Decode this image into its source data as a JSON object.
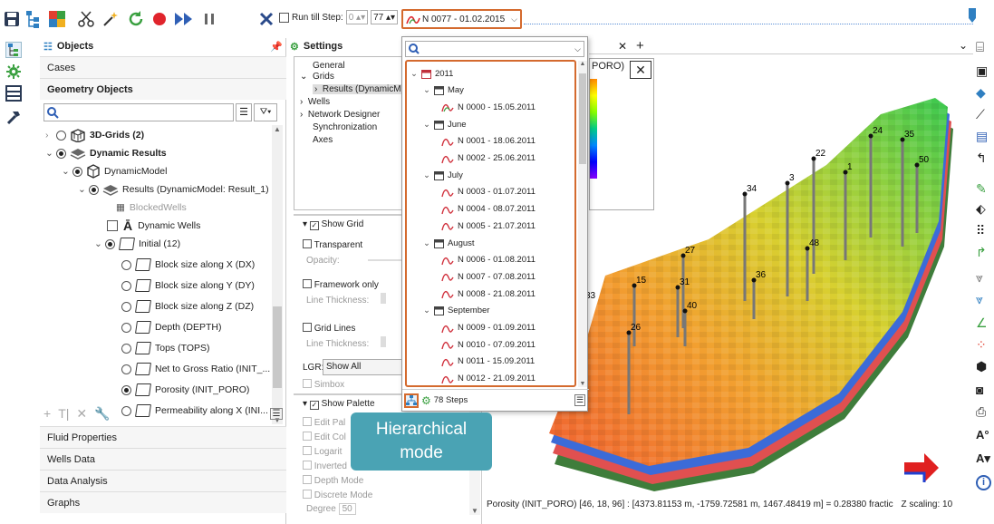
{
  "toolbar": {
    "run_till_label": "Run till Step:",
    "step_from": "0",
    "step_to": "77",
    "step_selector": "N 0077 - 01.02.2015"
  },
  "objects": {
    "title": "Objects",
    "sections_top": [
      "Cases",
      "Geometry Objects"
    ],
    "tree": [
      {
        "label": "3D-Grids (2)"
      },
      {
        "label": "Dynamic Results"
      },
      {
        "label": "DynamicModel"
      },
      {
        "label": "Results (DynamicModel: Result_1)"
      },
      {
        "label": "BlockedWells"
      },
      {
        "label": "Dynamic Wells"
      },
      {
        "label": "Initial (12)"
      },
      {
        "label": "Block size along X (DX)"
      },
      {
        "label": "Block size along Y (DY)"
      },
      {
        "label": "Block size along Z (DZ)"
      },
      {
        "label": "Depth (DEPTH)"
      },
      {
        "label": "Tops (TOPS)"
      },
      {
        "label": "Net to Gross Ratio (INIT_..."
      },
      {
        "label": "Porosity (INIT_PORO)"
      },
      {
        "label": "Permeability along X (INI..."
      }
    ],
    "sections_bottom": [
      "Fluid Properties",
      "Wells Data",
      "Data Analysis",
      "Graphs"
    ]
  },
  "settings": {
    "title": "Settings",
    "nav": [
      "General",
      "Grids",
      "Results (DynamicM",
      "Wells",
      "Network Designer",
      "Synchronization",
      "Axes"
    ],
    "show_grid": "Show Grid",
    "transparent": "Transparent",
    "opacity": "Opacity:",
    "framework_only": "Framework only",
    "line_thickness": "Line Thickness:",
    "grid_lines": "Grid Lines",
    "line_thickness2": "Line Thickness:",
    "lgr_label": "LGR:",
    "lgr_value": "Show All",
    "simbox": "Simbox",
    "show_palette": "Show Palette",
    "palette_opts": [
      "Edit Pal",
      "Edit Col",
      "Logarit",
      "Inverted",
      "Depth Mode",
      "Discrete Mode"
    ],
    "degree_label": "Degree",
    "degree_value": "50"
  },
  "popup": {
    "items": [
      {
        "label": "2011",
        "kind": "year"
      },
      {
        "label": "May",
        "kind": "month"
      },
      {
        "label": "N 0000 - 15.05.2011",
        "kind": "step"
      },
      {
        "label": "June",
        "kind": "month"
      },
      {
        "label": "N 0001 - 18.06.2011",
        "kind": "step"
      },
      {
        "label": "N 0002 - 25.06.2011",
        "kind": "step"
      },
      {
        "label": "July",
        "kind": "month"
      },
      {
        "label": "N 0003 - 01.07.2011",
        "kind": "step"
      },
      {
        "label": "N 0004 - 08.07.2011",
        "kind": "step"
      },
      {
        "label": "N 0005 - 21.07.2011",
        "kind": "step"
      },
      {
        "label": "August",
        "kind": "month"
      },
      {
        "label": "N 0006 - 01.08.2011",
        "kind": "step"
      },
      {
        "label": "N 0007 - 07.08.2011",
        "kind": "step"
      },
      {
        "label": "N 0008 - 21.08.2011",
        "kind": "step"
      },
      {
        "label": "September",
        "kind": "month"
      },
      {
        "label": "N 0009 - 01.09.2011",
        "kind": "step"
      },
      {
        "label": "N 0010 - 07.09.2011",
        "kind": "step"
      },
      {
        "label": "N 0011 - 15.09.2011",
        "kind": "step"
      },
      {
        "label": "N 0012 - 21.09.2011",
        "kind": "step"
      }
    ],
    "steps_count": "78 Steps"
  },
  "tooltip": {
    "line1": "Hierarchical",
    "line2": "mode"
  },
  "view": {
    "legend_title": "PORO)",
    "wells": [
      "24",
      "35",
      "22",
      "1",
      "50",
      "34",
      "3",
      "48",
      "27",
      "36",
      "15",
      "31",
      "40",
      "26",
      "33"
    ],
    "status": "Porosity (INIT_PORO) [46, 18, 96] : [4373.81153 m, -1759.72581 m, 1467.48419 m] = 0.28380 fractic",
    "zscale": "Z scaling: 10"
  },
  "colors": {
    "accent": "#d46a2e",
    "tooltip": "#4aa3b4"
  }
}
